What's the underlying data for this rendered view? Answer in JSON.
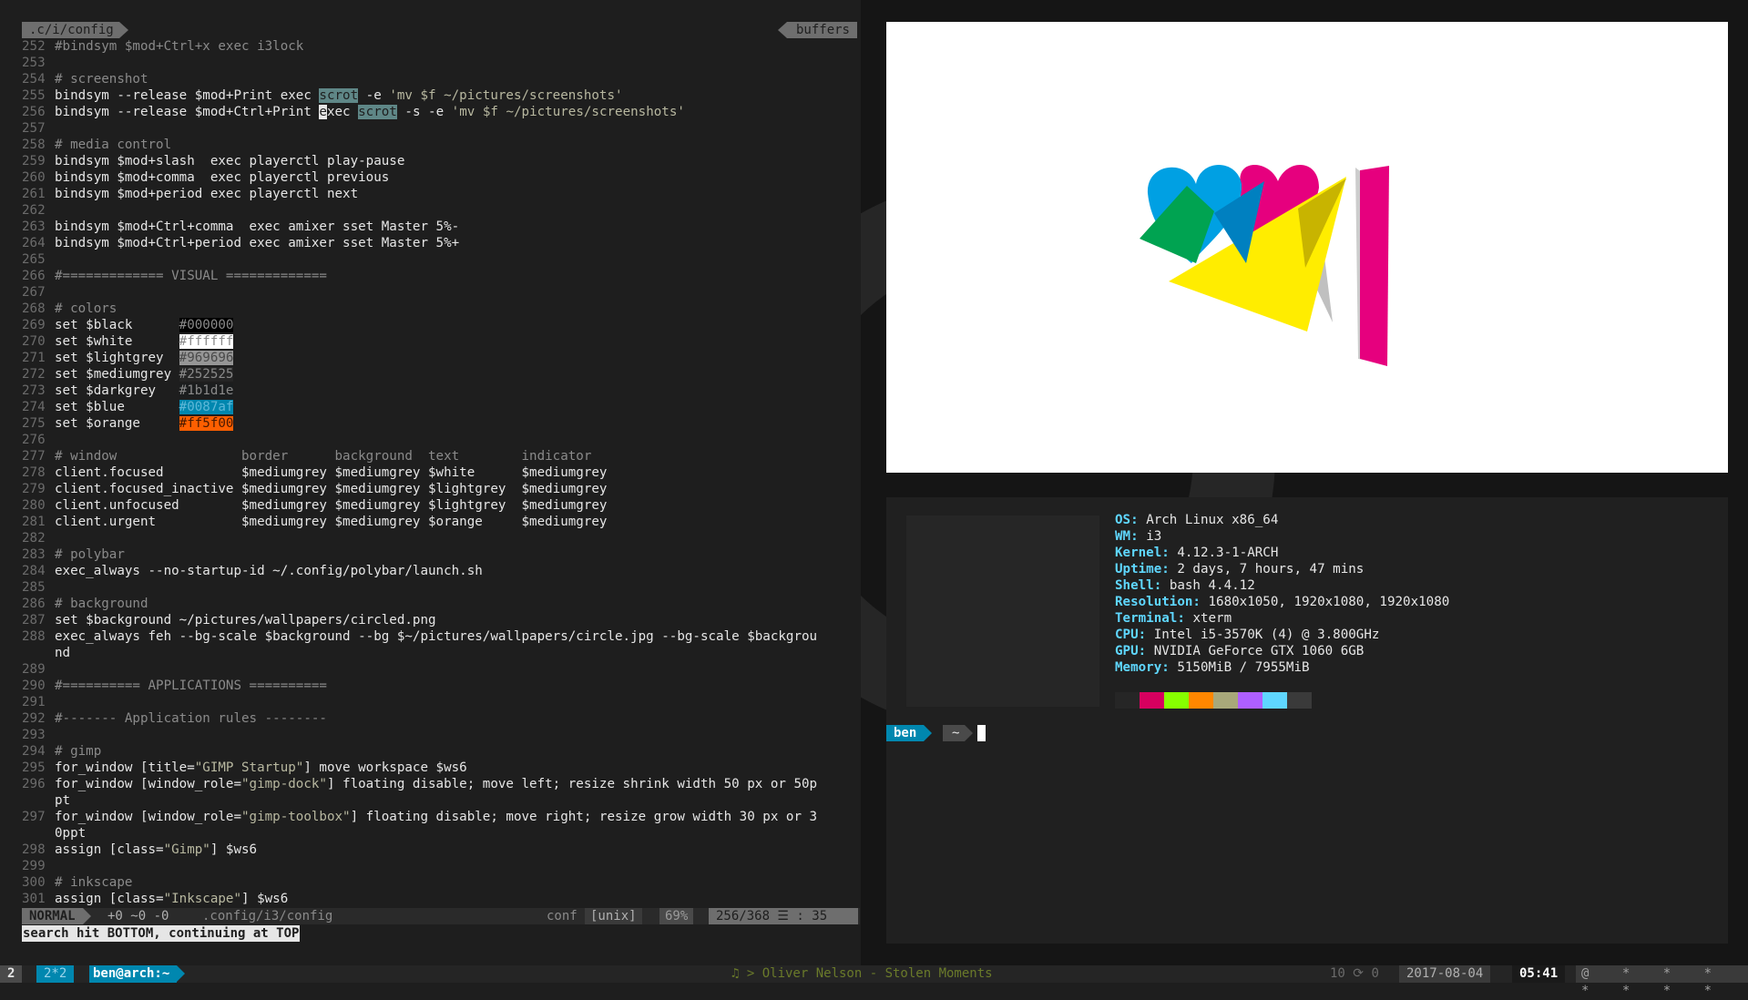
{
  "vim": {
    "tab_file": ".c/i/config",
    "tab_buffers": "buffers",
    "status": {
      "mode": "NORMAL",
      "git": "+0 ~0 -0",
      "path": ".config/i3/config",
      "filetype": "conf",
      "encoding": "[unix]",
      "percent": "69%",
      "position": "256/368 ☰ : 35"
    },
    "cmdline": "search hit BOTTOM, continuing at TOP"
  },
  "terminal": {
    "sysinfo": [
      {
        "key": "OS",
        "value": "Arch Linux x86_64"
      },
      {
        "key": "WM",
        "value": "i3"
      },
      {
        "key": "Kernel",
        "value": "4.12.3-1-ARCH"
      },
      {
        "key": "Uptime",
        "value": "2 days, 7 hours, 47 mins"
      },
      {
        "key": "Shell",
        "value": "bash 4.4.12"
      },
      {
        "key": "Resolution",
        "value": "1680x1050, 1920x1080, 1920x1080"
      },
      {
        "key": "Terminal",
        "value": "xterm"
      },
      {
        "key": "CPU",
        "value": "Intel i5-3570K (4) @ 3.800GHz"
      },
      {
        "key": "GPU",
        "value": "NVIDIA GeForce GTX 1060 6GB"
      },
      {
        "key": "Memory",
        "value": "5150MiB / 7955MiB"
      }
    ],
    "palette": [
      "#262626",
      "#d7005f",
      "#87ff00",
      "#ff8700",
      "#a8a87a",
      "#af5fff",
      "#5fd7ff",
      "#3a3a3a"
    ],
    "prompt_user": "ben",
    "prompt_dir": "~"
  },
  "polybar": {
    "ws1": "2",
    "ws2": "2*2",
    "window_title": "ben@arch:~",
    "music": "♫ > Oliver Nelson - Stolen Moments",
    "updates": "10 ⟳ 0",
    "date": "2017-08-04",
    "time": "05:41",
    "tray": "@ * * * * * * *"
  },
  "colors": {
    "accent": "#0087af",
    "orange": "#ff5f00"
  }
}
